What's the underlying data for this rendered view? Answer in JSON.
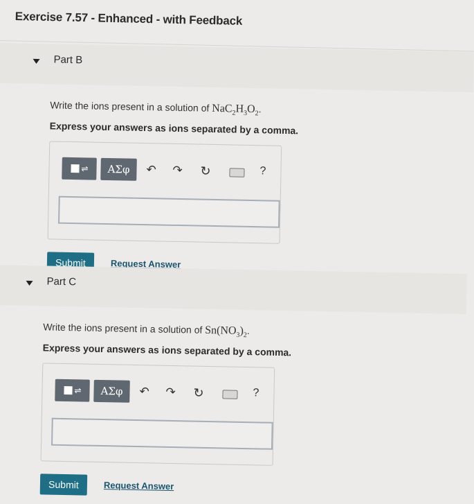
{
  "page": {
    "title": "Exercise 7.57 - Enhanced - with Feedback"
  },
  "parts": [
    {
      "label": "Part B",
      "question_prefix": "Write the ions present in a solution of ",
      "formula": [
        {
          "t": "NaC"
        },
        {
          "sub": "2"
        },
        {
          "t": "H"
        },
        {
          "sub": "3"
        },
        {
          "t": "O"
        },
        {
          "sub": "2"
        }
      ],
      "question_suffix": ".",
      "instruction": "Express your answers as ions separated by a comma.",
      "input_value": "",
      "submit_label": "Submit",
      "request_label": "Request Answer"
    },
    {
      "label": "Part C",
      "question_prefix": "Write the ions present in a solution of ",
      "formula": [
        {
          "t": "Sn(NO"
        },
        {
          "sub": "3"
        },
        {
          "t": ")"
        },
        {
          "sub": "2"
        }
      ],
      "question_suffix": ".",
      "instruction": "Express your answers as ions separated by a comma.",
      "input_value": "",
      "submit_label": "Submit",
      "request_label": "Request Answer"
    }
  ],
  "toolbar": {
    "template_icon": "templates-icon",
    "greek_label": "ΑΣφ",
    "undo_icon": "undo-icon",
    "redo_icon": "redo-icon",
    "reset_icon": "reset-icon",
    "keyboard_icon": "keyboard-icon",
    "help_label": "?"
  },
  "colors": {
    "submit": "#1e6f86",
    "link": "#1a5570",
    "toolbar_button": "#5f6770"
  }
}
